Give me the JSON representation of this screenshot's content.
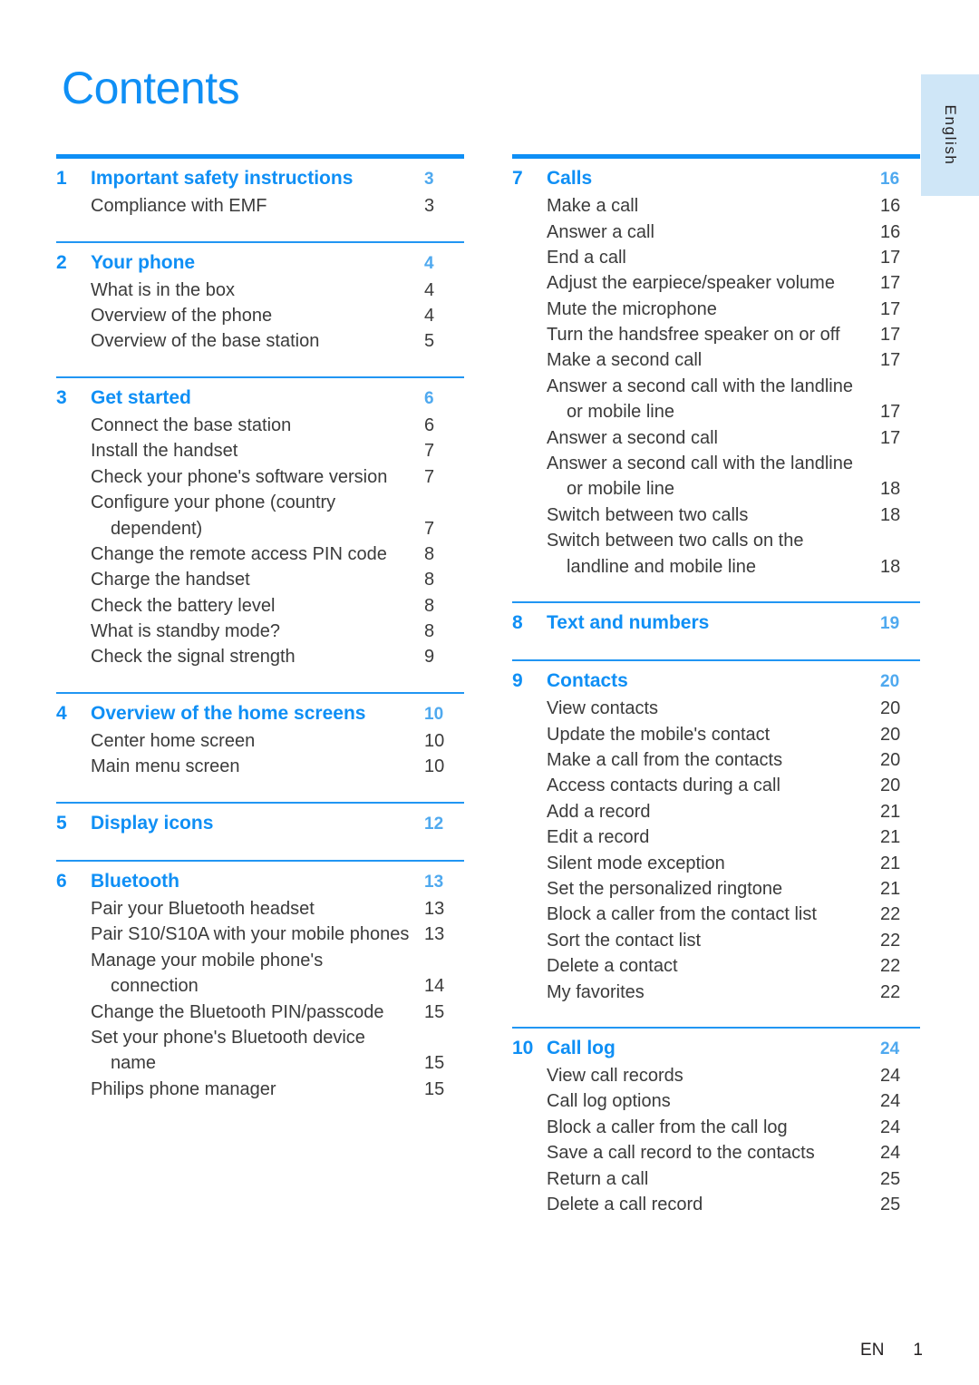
{
  "page_title": "Contents",
  "language_tab": "English",
  "footer": {
    "language_code": "EN",
    "page_number": "1"
  },
  "colors": {
    "accent_blue": "#0f8ff5",
    "rule_blue": "#2196f3",
    "tab_background": "#cfe6f7",
    "body_text": "#3b3b3b"
  },
  "columns": [
    {
      "name": "left",
      "sections": [
        {
          "number": "1",
          "title": "Important safety instructions",
          "page": "3",
          "rule": "thick",
          "entries": [
            {
              "text": "Compliance with EMF",
              "page": "3"
            }
          ]
        },
        {
          "number": "2",
          "title": "Your phone",
          "page": "4",
          "rule": "thin",
          "entries": [
            {
              "text": "What is in the box",
              "page": "4"
            },
            {
              "text": "Overview of the phone",
              "page": "4"
            },
            {
              "text": "Overview of the base station",
              "page": "5"
            }
          ]
        },
        {
          "number": "3",
          "title": "Get started",
          "page": "6",
          "rule": "thin",
          "entries": [
            {
              "text": "Connect the base station",
              "page": "6"
            },
            {
              "text": "Install the handset",
              "page": "7"
            },
            {
              "text": "Check your phone's software version",
              "page": "7"
            },
            {
              "text": "Configure your phone (country",
              "text2": "dependent)",
              "page": "7"
            },
            {
              "text": "Change the remote access PIN code",
              "page": "8"
            },
            {
              "text": "Charge the handset",
              "page": "8"
            },
            {
              "text": "Check the battery level",
              "page": "8"
            },
            {
              "text": "What is standby mode?",
              "page": "8"
            },
            {
              "text": "Check the signal strength",
              "page": "9"
            }
          ]
        },
        {
          "number": "4",
          "title": "Overview of the home screens",
          "page": "10",
          "rule": "thin",
          "entries": [
            {
              "text": "Center home screen",
              "page": "10"
            },
            {
              "text": "Main menu screen",
              "page": "10"
            }
          ]
        },
        {
          "number": "5",
          "title": "Display icons",
          "page": "12",
          "rule": "thin",
          "entries": []
        },
        {
          "number": "6",
          "title": "Bluetooth",
          "page": "13",
          "rule": "thin",
          "entries": [
            {
              "text": "Pair your Bluetooth headset",
              "page": "13"
            },
            {
              "text": "Pair S10/S10A with your mobile phones",
              "page": "13"
            },
            {
              "text": "Manage your mobile phone's",
              "text2": "connection",
              "page": "14"
            },
            {
              "text": "Change the Bluetooth PIN/passcode",
              "page": "15"
            },
            {
              "text": "Set your phone's Bluetooth device",
              "text2": "name",
              "page": "15"
            },
            {
              "text": "Philips phone manager",
              "page": "15"
            }
          ]
        }
      ]
    },
    {
      "name": "right",
      "sections": [
        {
          "number": "7",
          "title": "Calls",
          "page": "16",
          "rule": "thick",
          "entries": [
            {
              "text": "Make a call",
              "page": "16"
            },
            {
              "text": "Answer a call",
              "page": "16"
            },
            {
              "text": "End a call",
              "page": "17"
            },
            {
              "text": "Adjust the earpiece/speaker volume",
              "page": "17"
            },
            {
              "text": "Mute the microphone",
              "page": "17"
            },
            {
              "text": "Turn the handsfree speaker on or off",
              "page": "17"
            },
            {
              "text": "Make a second call",
              "page": "17"
            },
            {
              "text": "Answer a second call with the landline",
              "text2": "or mobile line",
              "page": "17"
            },
            {
              "text": "Answer a second call",
              "page": "17"
            },
            {
              "text": "Answer a second call with the landline",
              "text2": "or mobile line",
              "page": "18"
            },
            {
              "text": "Switch between two calls",
              "page": "18"
            },
            {
              "text": "Switch between two calls on the",
              "text2": "landline and mobile line",
              "page": "18"
            }
          ]
        },
        {
          "number": "8",
          "title": "Text and numbers",
          "page": "19",
          "rule": "thin",
          "entries": []
        },
        {
          "number": "9",
          "title": "Contacts",
          "page": "20",
          "rule": "thin",
          "entries": [
            {
              "text": "View contacts",
              "page": "20"
            },
            {
              "text": "Update the mobile's contact",
              "page": "20"
            },
            {
              "text": "Make a call from the contacts",
              "page": "20"
            },
            {
              "text": "Access contacts during a call",
              "page": "20"
            },
            {
              "text": "Add a record",
              "page": "21"
            },
            {
              "text": "Edit a record",
              "page": "21"
            },
            {
              "text": "Silent mode exception",
              "page": "21"
            },
            {
              "text": "Set the personalized ringtone",
              "page": "21"
            },
            {
              "text": "Block a caller from the contact list",
              "page": "22"
            },
            {
              "text": "Sort the contact list",
              "page": "22"
            },
            {
              "text": "Delete a contact",
              "page": "22"
            },
            {
              "text": "My favorites",
              "page": "22"
            }
          ]
        },
        {
          "number": "10",
          "title": "Call log",
          "page": "24",
          "rule": "thin",
          "entries": [
            {
              "text": "View call records",
              "page": "24"
            },
            {
              "text": "Call log options",
              "page": "24"
            },
            {
              "text": "Block a caller from the call log",
              "page": "24"
            },
            {
              "text": "Save a call record to the contacts",
              "page": "24"
            },
            {
              "text": "Return a call",
              "page": "25"
            },
            {
              "text": "Delete a call record",
              "page": "25"
            }
          ]
        }
      ]
    }
  ]
}
